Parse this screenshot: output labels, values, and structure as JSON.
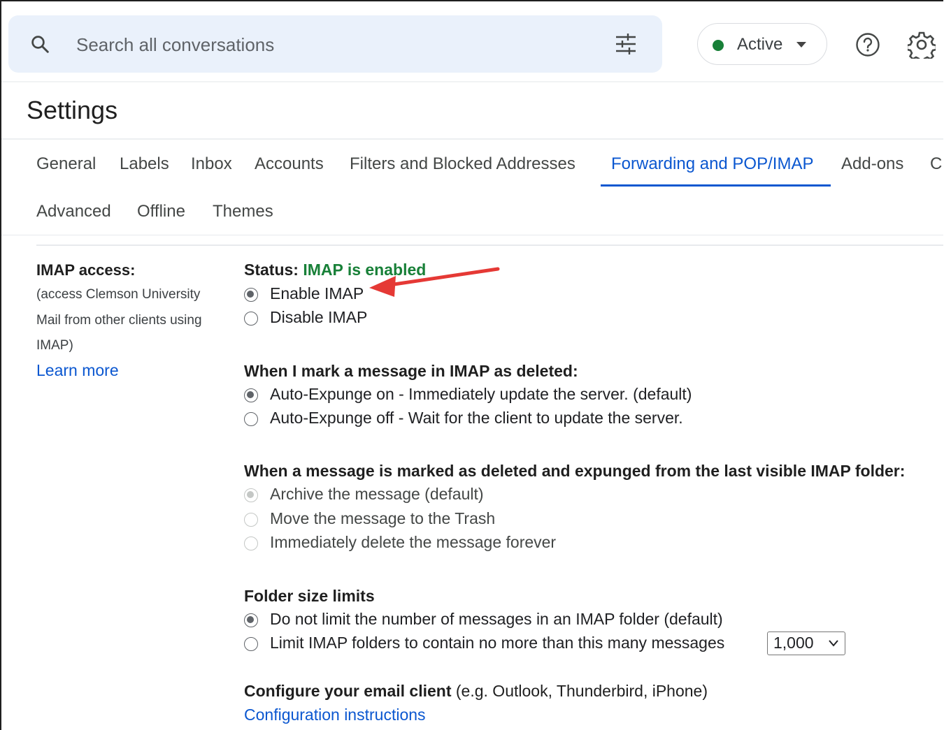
{
  "search": {
    "placeholder": "Search all conversations"
  },
  "status_chip": {
    "label": "Active",
    "dot_color": "#188038"
  },
  "header": {
    "title": "Settings"
  },
  "tabs": [
    {
      "label": "General"
    },
    {
      "label": "Labels"
    },
    {
      "label": "Inbox"
    },
    {
      "label": "Accounts"
    },
    {
      "label": "Filters and Blocked Addresses"
    },
    {
      "label": "Forwarding and POP/IMAP",
      "active": true
    },
    {
      "label": "Add-ons"
    },
    {
      "label": "C"
    },
    {
      "label": "Advanced"
    },
    {
      "label": "Offline"
    },
    {
      "label": "Themes"
    }
  ],
  "imap_section": {
    "heading": "IMAP access:",
    "description_lines": [
      "(access Clemson University",
      "Mail from other clients using",
      "IMAP)"
    ],
    "learn_more": "Learn more"
  },
  "status": {
    "label": "Status:",
    "value": "IMAP is enabled",
    "value_color": "#188038"
  },
  "imap_options": [
    {
      "label": "Enable IMAP",
      "checked": true
    },
    {
      "label": "Disable IMAP",
      "checked": false
    }
  ],
  "deleted_section": {
    "heading": "When I mark a message in IMAP as deleted:",
    "options": [
      {
        "label": "Auto-Expunge on - Immediately update the server. (default)",
        "checked": true
      },
      {
        "label": "Auto-Expunge off - Wait for the client to update the server.",
        "checked": false
      }
    ]
  },
  "expunged_section": {
    "heading": "When a message is marked as deleted and expunged from the last visible IMAP folder:",
    "options": [
      {
        "label": "Archive the message (default)",
        "checked": true,
        "disabled": true
      },
      {
        "label": "Move the message to the Trash",
        "checked": false,
        "disabled": true
      },
      {
        "label": "Immediately delete the message forever",
        "checked": false,
        "disabled": true
      }
    ]
  },
  "folder_section": {
    "heading": "Folder size limits",
    "options": [
      {
        "label": "Do not limit the number of messages in an IMAP folder (default)",
        "checked": true
      },
      {
        "label": "Limit IMAP folders to contain no more than this many messages",
        "checked": false
      }
    ],
    "limit_value": "1,000"
  },
  "configure": {
    "heading": "Configure your email client",
    "note": "(e.g. Outlook, Thunderbird, iPhone)",
    "link": "Configuration instructions"
  },
  "annotation_arrow_color": "#e53935",
  "accent_color": "#0b57d0"
}
